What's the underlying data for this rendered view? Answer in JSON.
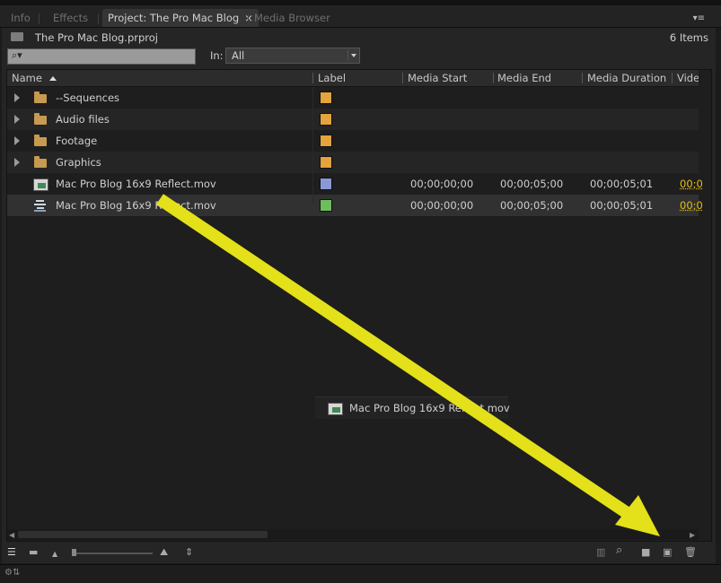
{
  "tabs": [
    {
      "label": "Info",
      "active": false
    },
    {
      "label": "Effects",
      "active": false
    },
    {
      "label": "Project: The Pro Mac Blog",
      "active": true
    },
    {
      "label": "Media Browser",
      "active": false
    }
  ],
  "tab_close": "×",
  "panel_menu": "▾≡",
  "project": {
    "file": "The Pro Mac Blog.prproj",
    "items": "6 Items"
  },
  "search": {
    "icon": "⌕▾",
    "value": ""
  },
  "in_filter": {
    "label": "In:",
    "value": "All"
  },
  "columns": [
    "Name",
    "Label",
    "Media Start",
    "Media End",
    "Media Duration",
    "Video In"
  ],
  "rows": [
    {
      "type": "bin",
      "name": "--Sequences",
      "label_color": "#e3a33d"
    },
    {
      "type": "bin",
      "name": "Audio files",
      "label_color": "#e3a33d"
    },
    {
      "type": "bin",
      "name": "Footage",
      "label_color": "#e3a33d"
    },
    {
      "type": "bin",
      "name": "Graphics",
      "label_color": "#e3a33d"
    },
    {
      "type": "clip",
      "name": "Mac Pro Blog 16x9 Reflect.mov",
      "label_color": "#8a98d6",
      "media_start": "00;00;00;00",
      "media_end": "00;00;05;00",
      "media_duration": "00;00;05;01",
      "video_in": "00;0"
    },
    {
      "type": "sequence",
      "name": "Mac Pro Blog 16x9 Reflect.mov",
      "label_color": "#6fbd5e",
      "media_start": "00;00;00;00",
      "media_end": "00;00;05;00",
      "media_duration": "00;00;05;01",
      "video_in": "00;0"
    }
  ],
  "drag_ghost": {
    "name": "Mac Pro Blog 16x9 Reflect.mov"
  },
  "annotation": {
    "color": "#e4e01a"
  },
  "icons": {
    "list_view": "list-view-icon",
    "icon_view": "icon-view-icon",
    "zoom_small": "mountain-small-icon",
    "zoom_large": "mountain-large-icon",
    "sort": "sort-icon",
    "automate": "automate-to-sequence-icon",
    "find": "find-icon",
    "new_bin": "new-bin-icon",
    "new_item": "new-item-icon",
    "clear": "trash-icon"
  },
  "bottom_glyphs": {
    "list": "☰",
    "icon": "▬",
    "zs": "▲",
    "zl": "⛰",
    "sort": "⇕",
    "auto": "▥",
    "find": "⌕",
    "bin": "■",
    "item": "▣",
    "trash": "🗑"
  },
  "status_glyph": "⚙⇅"
}
